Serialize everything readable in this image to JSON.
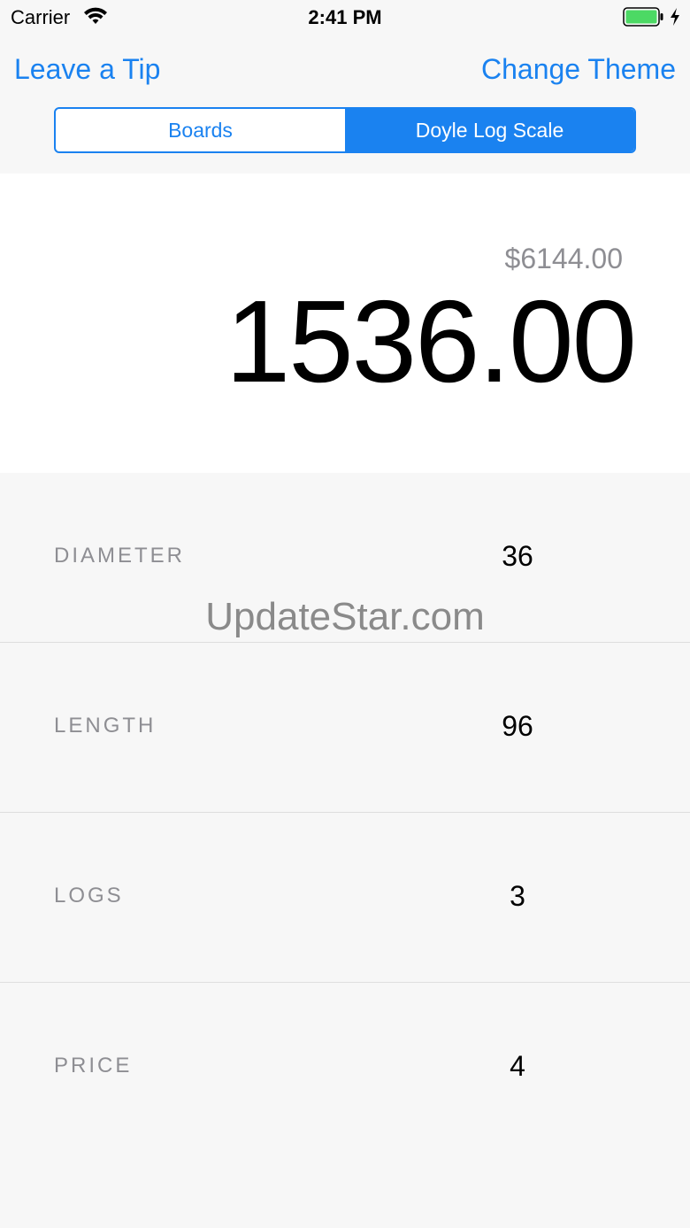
{
  "status_bar": {
    "carrier": "Carrier",
    "time": "2:41 PM",
    "icons": [
      "wifi-icon",
      "battery-icon",
      "charging-bolt-icon"
    ],
    "battery_color": "#4cd964"
  },
  "nav": {
    "left_button": "Leave a Tip",
    "right_button": "Change Theme"
  },
  "segmented_control": {
    "segments": [
      {
        "label": "Boards",
        "selected": false
      },
      {
        "label": "Doyle Log Scale",
        "selected": true
      }
    ]
  },
  "result": {
    "price_total": "$6144.00",
    "board_feet": "1536.00"
  },
  "inputs": [
    {
      "label": "DIAMETER",
      "value": "36"
    },
    {
      "label": "LENGTH",
      "value": "96"
    },
    {
      "label": "LOGS",
      "value": "3"
    },
    {
      "label": "PRICE",
      "value": "4"
    }
  ],
  "watermark": "UpdateStar.com",
  "colors": {
    "accent": "#1a82f0",
    "secondary_text": "#8e8e93",
    "background": "#f7f7f7"
  }
}
